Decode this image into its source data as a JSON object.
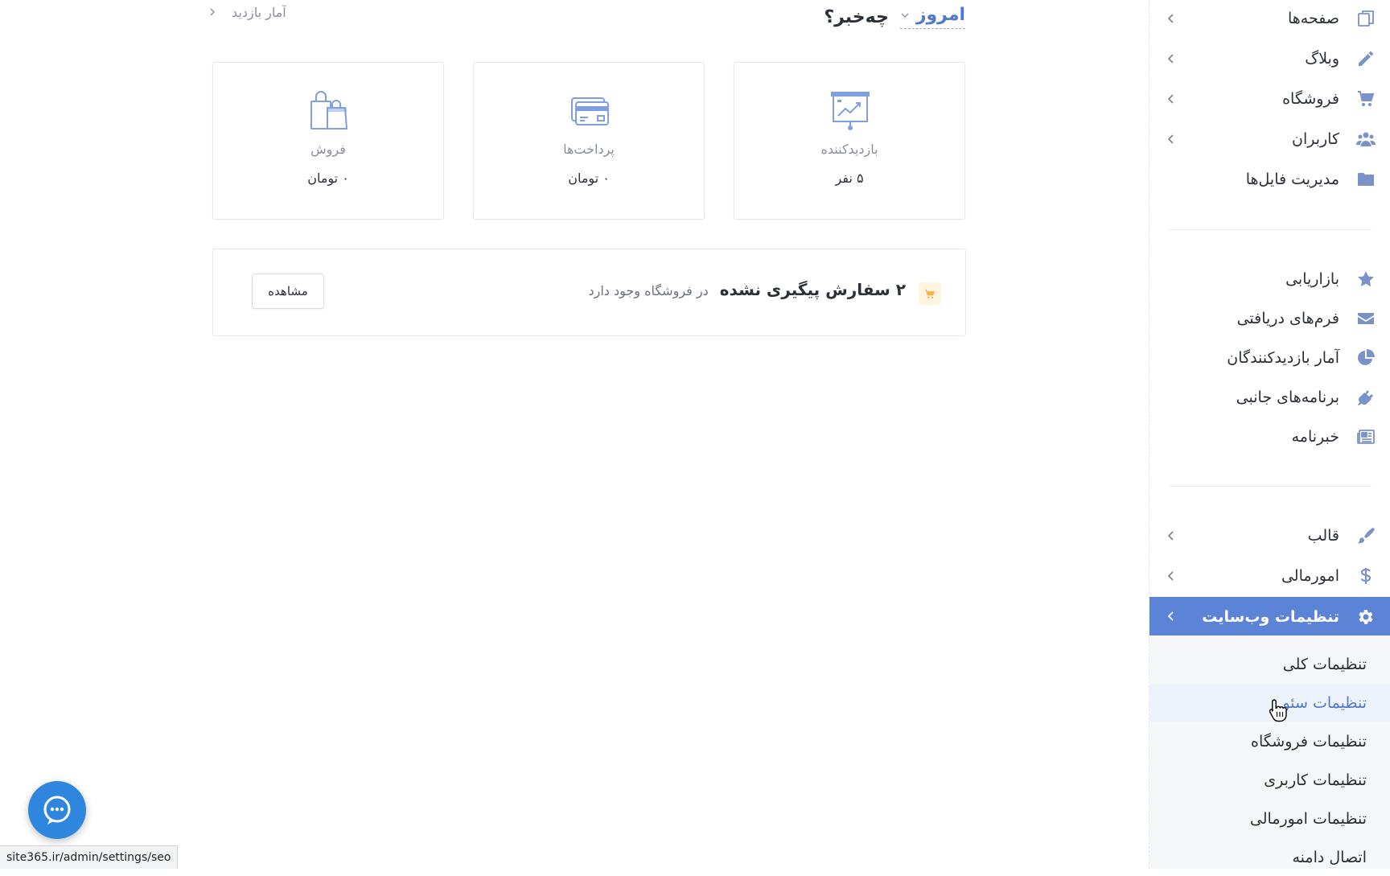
{
  "header": {
    "question": "چه‌خبر؟",
    "period": "امروز",
    "breadcrumb": "آمار بازدید"
  },
  "stats": [
    {
      "name": "بازدیدکننده",
      "value": "۵ نفر",
      "icon": "presentation-chart-icon"
    },
    {
      "name": "پرداخت‌ها",
      "value": "۰ تومان",
      "icon": "credit-cards-icon"
    },
    {
      "name": "فروش",
      "value": "۰ تومان",
      "icon": "shopping-bags-icon"
    }
  ],
  "notice": {
    "main": "۲ سفارش پیگیری نشده",
    "sub": "در فروشگاه وجود دارد",
    "button": "مشاهده",
    "icon": "cart-icon"
  },
  "sidebar": {
    "group1": [
      {
        "label": "صفحه‌ها",
        "icon": "pages-icon",
        "has_children": true
      },
      {
        "label": "وبلاگ",
        "icon": "pencil-icon",
        "has_children": true
      },
      {
        "label": "فروشگاه",
        "icon": "cart-icon",
        "has_children": true
      },
      {
        "label": "کاربران",
        "icon": "users-icon",
        "has_children": true
      },
      {
        "label": "مدیریت فایل‌ها",
        "icon": "folder-icon",
        "has_children": false
      }
    ],
    "group2": [
      {
        "label": "بازاریابی",
        "icon": "star-icon"
      },
      {
        "label": "فرم‌های دریافتی",
        "icon": "envelope-icon"
      },
      {
        "label": "آمار بازدیدکنندگان",
        "icon": "pie-chart-icon"
      },
      {
        "label": "برنامه‌های جانبی",
        "icon": "plug-icon"
      },
      {
        "label": "خبرنامه",
        "icon": "newspaper-icon"
      }
    ],
    "group3": [
      {
        "label": "قالب",
        "icon": "brush-icon",
        "has_children": true
      },
      {
        "label": "امورمالی",
        "icon": "dollar-icon",
        "has_children": true
      },
      {
        "label": "تنظیمات وب‌سایت",
        "icon": "gear-icon",
        "has_children": true,
        "active": true
      }
    ],
    "submenu": [
      {
        "label": "تنظیمات کلی"
      },
      {
        "label": "تنظیمات سئو",
        "hover": true
      },
      {
        "label": "تنظیمات فروشگاه"
      },
      {
        "label": "تنظیمات کاربری"
      },
      {
        "label": "تنظیمات امورمالی"
      },
      {
        "label": "اتصال دامنه"
      }
    ]
  },
  "status_url": "site365.ir/admin/settings/seo",
  "colors": {
    "accent": "#5b84d6",
    "icon_light": "#7fa0e0",
    "sidebar_icon": "#7a92c8"
  }
}
